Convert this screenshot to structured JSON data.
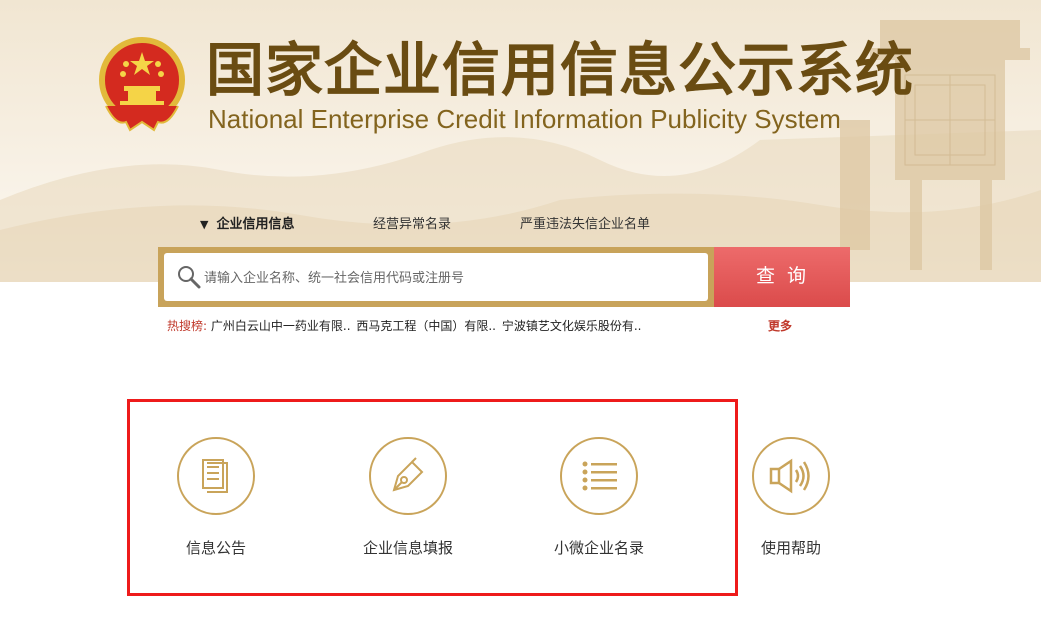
{
  "header": {
    "title_cn": "国家企业信用信息公示系统",
    "title_en": "National Enterprise Credit Information Publicity System"
  },
  "tabs": [
    {
      "label": "企业信用信息",
      "marker": "▼",
      "active": true
    },
    {
      "label": "经营异常名录",
      "active": false
    },
    {
      "label": "严重违法失信企业名单",
      "active": false
    }
  ],
  "search": {
    "placeholder": "请输入企业名称、统一社会信用代码或注册号",
    "value": "",
    "button_label": "查询"
  },
  "hot_search": {
    "label": "热搜榜:",
    "items": [
      "广州白云山中一药业有限..",
      "西马克工程（中国）有限..",
      "宁波镇艺文化娱乐股份有.."
    ],
    "more_label": "更多"
  },
  "features": [
    {
      "label": "信息公告",
      "icon": "document-icon"
    },
    {
      "label": "企业信息填报",
      "icon": "pen-nib-icon"
    },
    {
      "label": "小微企业名录",
      "icon": "list-icon"
    },
    {
      "label": "使用帮助",
      "icon": "speaker-icon"
    }
  ],
  "colors": {
    "title": "#6a4c12",
    "search_border": "#c8a35a",
    "search_button": "#e05555",
    "icon_gold": "#c9a45a",
    "highlight_box": "#ee1b1b",
    "hot_label": "#c0392b"
  }
}
